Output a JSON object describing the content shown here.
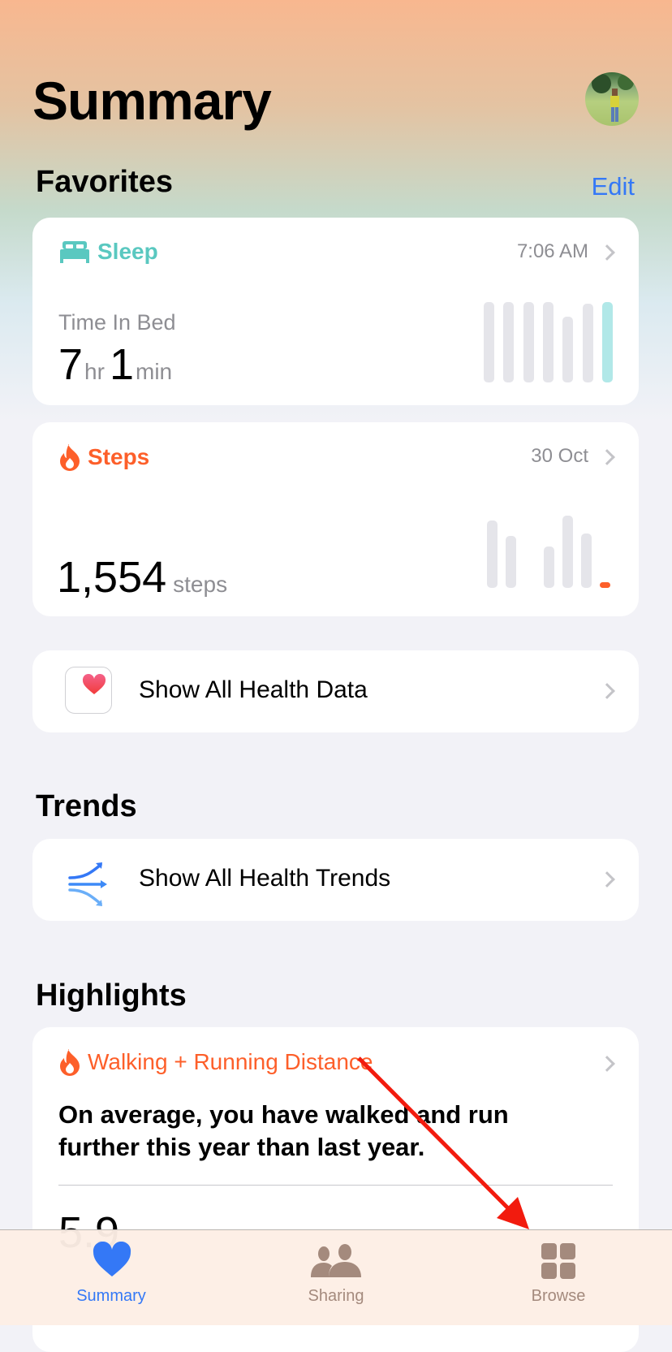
{
  "header": {
    "title": "Summary"
  },
  "favorites": {
    "title": "Favorites",
    "edit_label": "Edit"
  },
  "sleep": {
    "title": "Sleep",
    "time": "7:06 AM",
    "metric_label": "Time In Bed",
    "hours": "7",
    "hours_unit": "hr",
    "minutes": "1",
    "minutes_unit": "min",
    "color": "#5ac8c0",
    "chart_values": [
      1,
      1,
      1,
      1,
      0.82,
      0.98,
      1
    ]
  },
  "steps": {
    "title": "Steps",
    "date": "30 Oct",
    "value": "1,554",
    "unit": "steps",
    "color": "#fd5f2a",
    "chart_values": [
      0.93,
      0.72,
      0,
      0.57,
      1.0,
      0.75,
      0.08
    ]
  },
  "health_data": {
    "label": "Show All Health Data"
  },
  "trends": {
    "title": "Trends",
    "label": "Show All Health Trends"
  },
  "highlights": {
    "title": "Highlights",
    "card_title": "Walking + Running Distance",
    "body": "On average, you have walked and run further this year than last year.",
    "value": "5.9"
  },
  "tabs": [
    {
      "label": "Summary",
      "icon": "heart-icon",
      "active": true
    },
    {
      "label": "Sharing",
      "icon": "people-icon"
    },
    {
      "label": "Browse",
      "icon": "grid-icon"
    }
  ],
  "colors": {
    "accent": "#3478f6",
    "tab_inactive": "#a48a7d",
    "annotation_arrow": "#f21b0e"
  }
}
